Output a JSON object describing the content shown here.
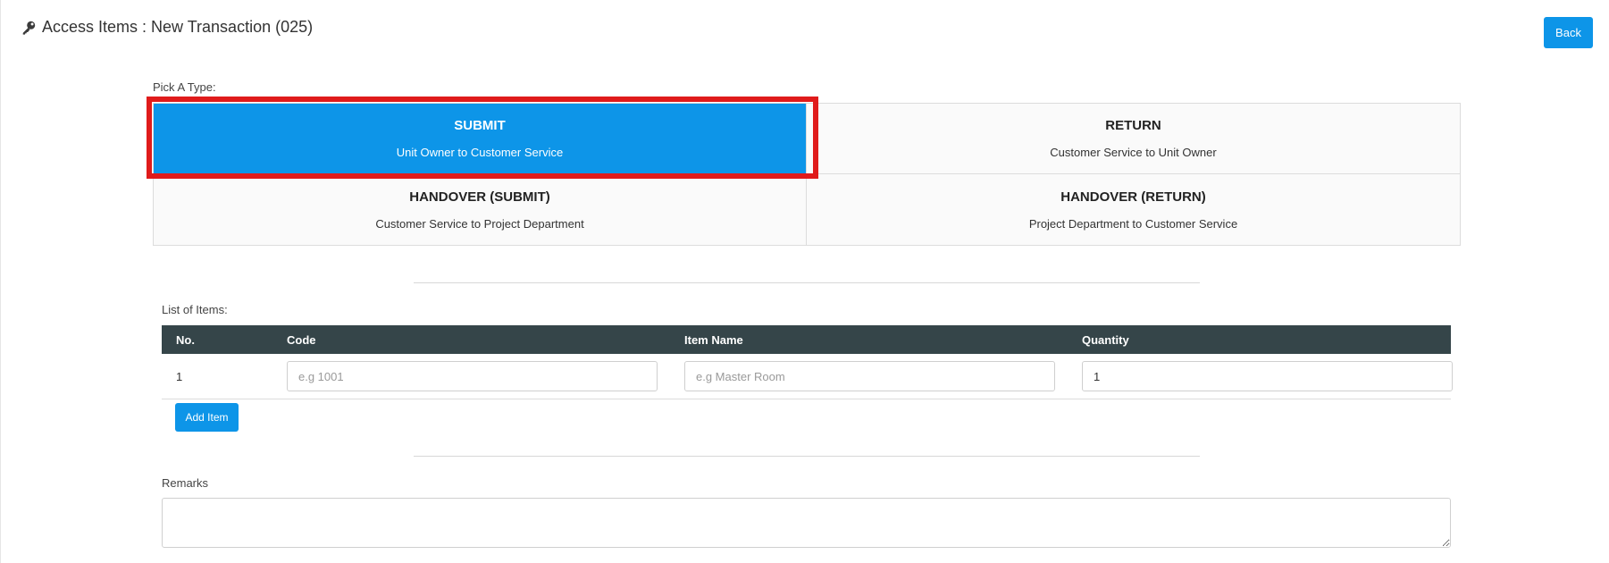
{
  "header": {
    "title": "Access Items : New Transaction (025)",
    "icon": "key-icon"
  },
  "back_button": {
    "label": "Back"
  },
  "pick_type": {
    "label": "Pick A Type:",
    "selected_color": "#0d95e8",
    "options": [
      {
        "title": "SUBMIT",
        "subtitle": "Unit Owner to Customer Service",
        "selected": true
      },
      {
        "title": "RETURN",
        "subtitle": "Customer Service to Unit Owner",
        "selected": false
      },
      {
        "title": "HANDOVER (SUBMIT)",
        "subtitle": "Customer Service to Project Department",
        "selected": false
      },
      {
        "title": "HANDOVER (RETURN)",
        "subtitle": "Project Department to Customer Service",
        "selected": false
      }
    ]
  },
  "items": {
    "label": "List of Items:",
    "columns": [
      "No.",
      "Code",
      "Item Name",
      "Quantity"
    ],
    "rows": [
      {
        "no": "1",
        "code": "",
        "code_placeholder": "e.g 1001",
        "item_name": "",
        "item_name_placeholder": "e.g Master Room",
        "quantity": "1"
      }
    ],
    "add_button": "Add Item"
  },
  "remarks": {
    "label": "Remarks",
    "value": ""
  }
}
